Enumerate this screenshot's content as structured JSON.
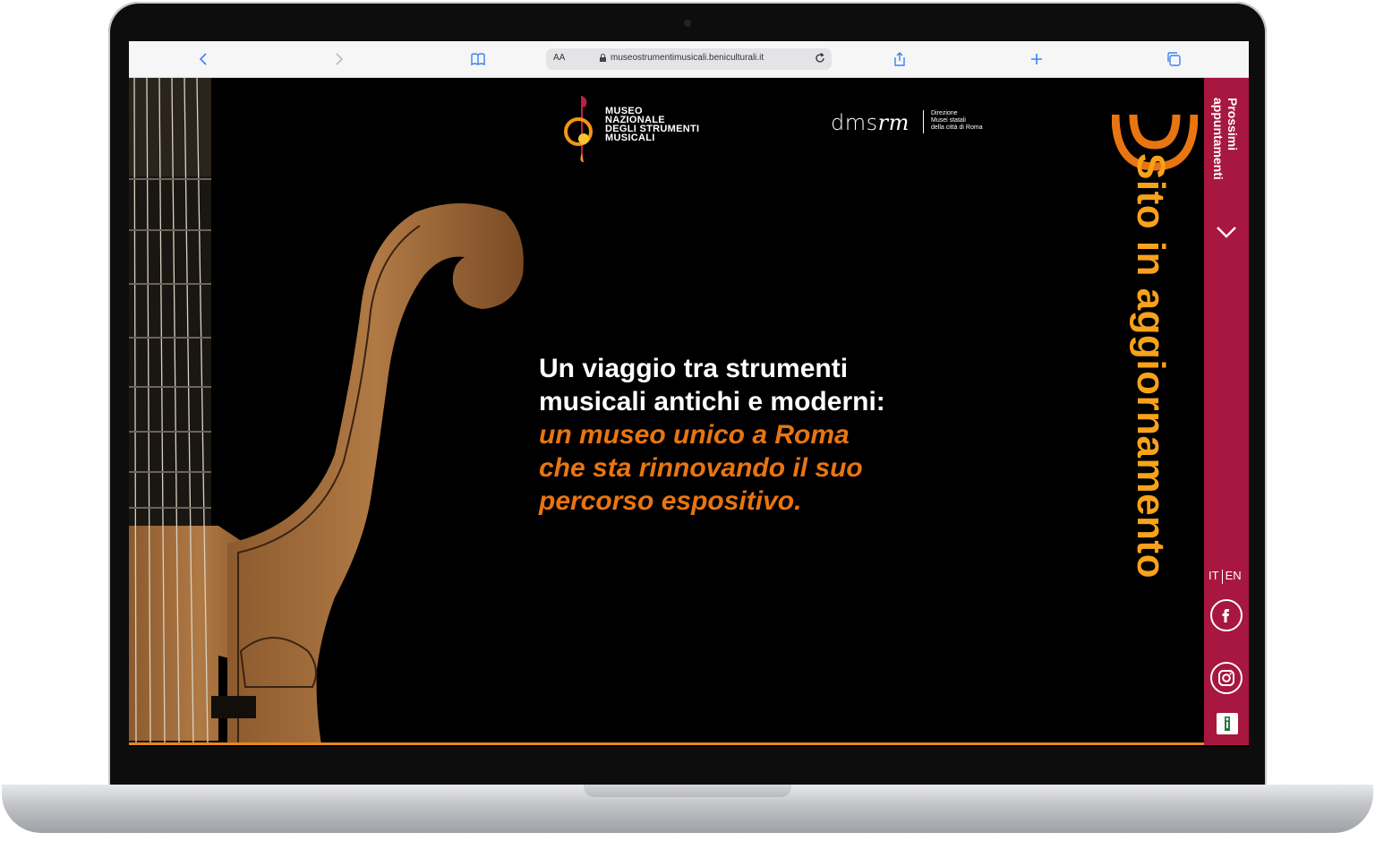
{
  "browser": {
    "url_text": "museostrumentimusicali.beniculturali.it",
    "text_size_label": "AA"
  },
  "header": {
    "museum_logo_lines": [
      "MUSEO",
      "NAZIONALE",
      "DEGLI STRUMENTI",
      "MUSICALI"
    ],
    "dms_logo_text_plain": "dms",
    "dms_logo_text_bold": "rm",
    "dms_sub_lines": [
      "Direzione",
      "Musei statali",
      "della città di Roma"
    ]
  },
  "hero": {
    "lines_white": [
      "Un viaggio tra strumenti",
      "musicali antichi e moderni:"
    ],
    "lines_orange": [
      " un museo unico a Roma",
      "che sta rinnovando il suo",
      "percorso espositivo."
    ]
  },
  "vertical_title": "Sito in aggiornamento",
  "sidebar": {
    "label_lines": [
      "Prossimi",
      "appuntamenti"
    ],
    "lang_it": "IT",
    "lang_en": "EN"
  },
  "colors": {
    "accent_orange": "#e87511",
    "title_yellow": "#f7a21a",
    "sidebar_crimson": "#a7173f"
  },
  "icons": [
    "back-icon",
    "forward-icon",
    "bookmarks-icon",
    "share-icon",
    "new-tab-icon",
    "tabs-icon",
    "facebook-icon",
    "instagram-icon",
    "accessibility-icon",
    "chevron-down-icon"
  ]
}
